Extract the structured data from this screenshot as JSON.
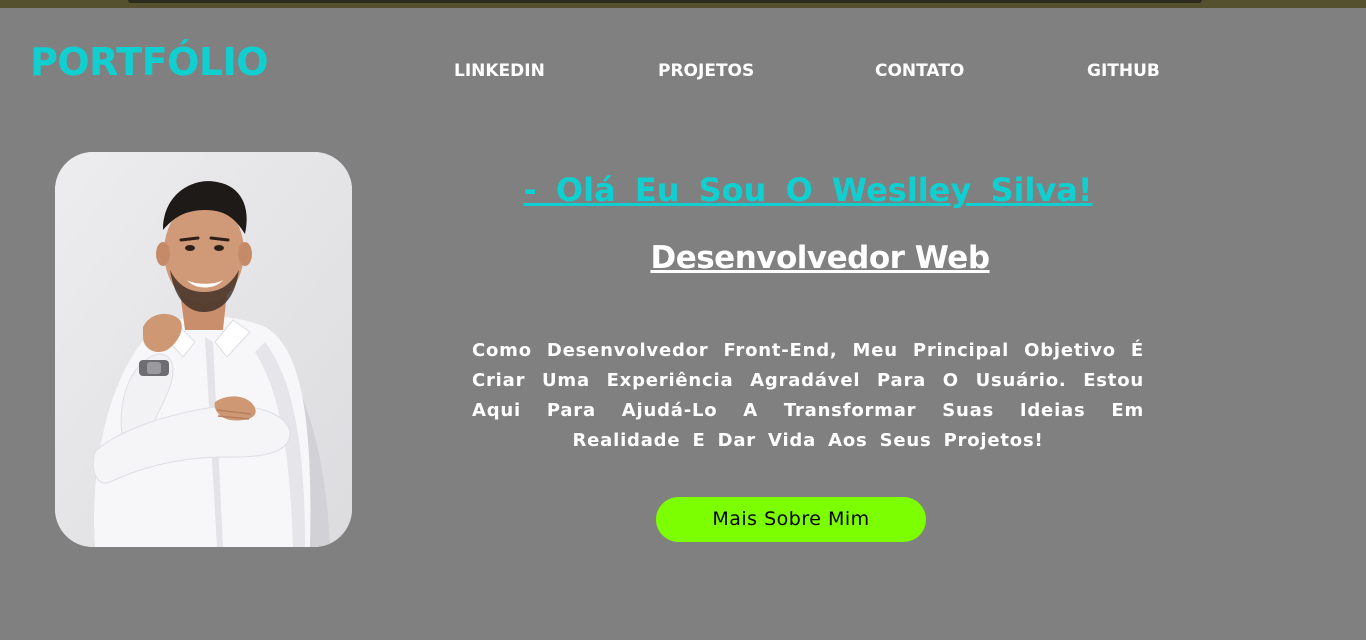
{
  "brand": {
    "logo_text": "PORTFÓLIO",
    "accent_color": "#10cfd1"
  },
  "nav": {
    "items": [
      {
        "label": "LINKEDIN"
      },
      {
        "label": "PROJETOS"
      },
      {
        "label": "CONTATO"
      },
      {
        "label": "GITHUB"
      }
    ]
  },
  "hero": {
    "greeting": "- Olá Eu Sou O Weslley Silva!",
    "role": "Desenvolvedor Web",
    "bio": "Como Desenvolvedor Front-End, Meu Principal Objetivo É Criar Uma Experiência Agradável Para O Usuário. Estou Aqui Para Ajudá-Lo A Transformar Suas Ideias Em Realidade E Dar Vida Aos Seus Projetos!",
    "cta_label": "Mais Sobre Mim",
    "cta_color": "#7cff00"
  },
  "theme": {
    "background": "#808080",
    "text_color": "#ffffff"
  }
}
